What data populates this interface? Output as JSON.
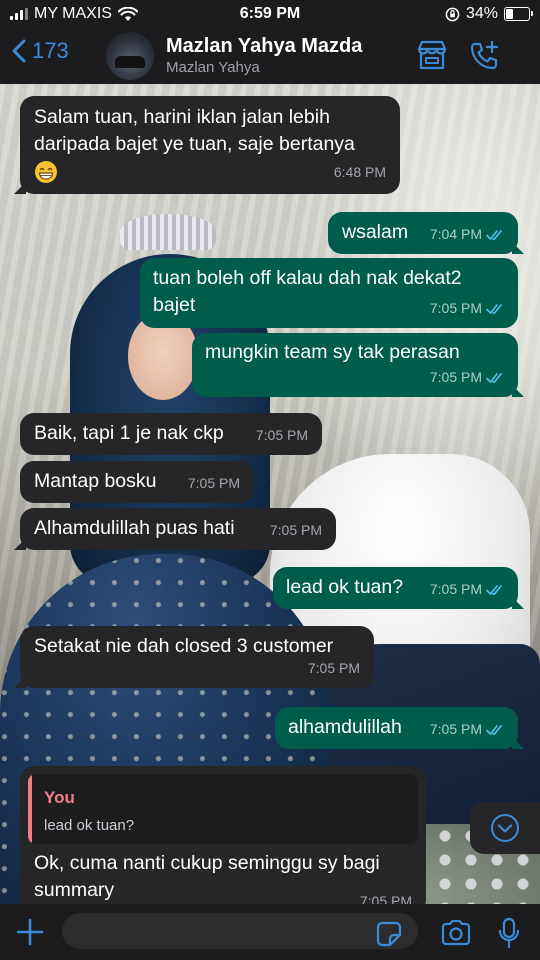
{
  "status_bar": {
    "carrier": "MY MAXIS",
    "time": "6:59 PM",
    "battery_text": "34%",
    "battery_level": 0.34
  },
  "header": {
    "back_count": "173",
    "contact_name": "Mazlan Yahya Mazda",
    "contact_subtitle": "Mazlan Yahya",
    "accent_color": "#3b8bd9"
  },
  "messages": [
    {
      "dir": "in",
      "text_lines": [
        "Salam tuan, harini iklan jalan lebih",
        "daripada bajet ye tuan, saje bertanya"
      ],
      "emoji": "grinning-face",
      "time": "6:48 PM"
    },
    {
      "dir": "out",
      "text": "wsalam",
      "time": "7:04 PM",
      "read": true
    },
    {
      "dir": "out",
      "text_lines": [
        "tuan boleh off kalau dah nak dekat2",
        "bajet"
      ],
      "time": "7:05 PM",
      "read": true
    },
    {
      "dir": "out",
      "text": "mungkin team sy tak perasan",
      "time": "7:05 PM",
      "read": true
    },
    {
      "dir": "in",
      "text": "Baik, tapi 1 je nak ckp",
      "time": "7:05 PM"
    },
    {
      "dir": "in",
      "text": "Mantap bosku",
      "time": "7:05 PM"
    },
    {
      "dir": "in",
      "text": "Alhamdulillah puas hati",
      "time": "7:05 PM"
    },
    {
      "dir": "out",
      "text": "lead ok tuan?",
      "time": "7:05 PM",
      "read": true
    },
    {
      "dir": "in",
      "text": "Setakat nie dah closed 3 customer",
      "time": "7:05 PM"
    },
    {
      "dir": "out",
      "text": "alhamdulillah",
      "time": "7:05 PM",
      "read": true
    },
    {
      "dir": "in",
      "reply_to": {
        "author": "You",
        "text": "lead ok tuan?"
      },
      "text_lines": [
        "Ok, cuma nanti cukup seminggu sy bagi",
        "summary"
      ],
      "time": "7:05 PM"
    }
  ],
  "colors": {
    "incoming_bubble": "#262628",
    "outgoing_bubble": "#005c4b",
    "read_tick": "#53bdeb",
    "reply_accent": "#f27d86"
  },
  "input": {
    "placeholder": "",
    "value": ""
  },
  "icons": {
    "back": "chevron-left-icon",
    "store": "store-icon",
    "add_call": "phone-plus-icon",
    "scroll_down": "chevron-down-circle-icon",
    "attach": "plus-icon",
    "sticker": "sticker-icon",
    "camera": "camera-icon",
    "mic": "microphone-icon"
  }
}
